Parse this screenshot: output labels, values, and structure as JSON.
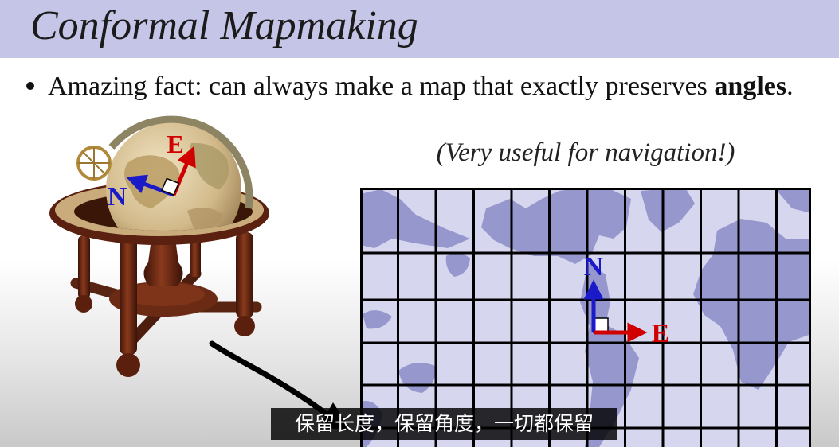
{
  "slide": {
    "title": "Conformal Mapmaking",
    "bullet": {
      "text": "Amazing fact: can always make a map that exactly preserves ",
      "emphasis": "angles",
      "end": "."
    },
    "note": "(Very useful for navigation!)"
  },
  "globe": {
    "north_label": "N",
    "east_label": "E"
  },
  "map": {
    "north_label": "N",
    "east_label": "E"
  },
  "subtitle": "保留长度，保留角度，一切都保留",
  "colors": {
    "title_bar": "#c5c5e7",
    "north": "#1a1ac8",
    "east": "#d00000",
    "ocean": "#d6d7ef",
    "land": "#9597cd"
  }
}
